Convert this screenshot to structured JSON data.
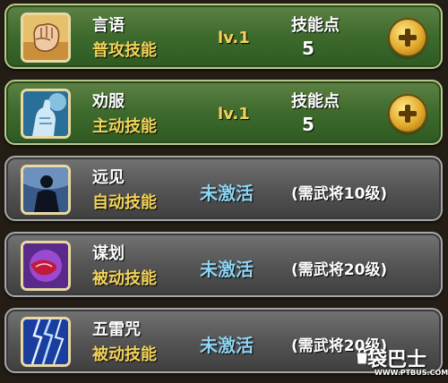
{
  "skills": [
    {
      "name": "言语",
      "type": "普攻技能",
      "level": "lv.1",
      "points_label": "技能点",
      "points_value": "5",
      "active": true,
      "icon": "fist-icon"
    },
    {
      "name": "劝服",
      "type": "主动技能",
      "level": "lv.1",
      "points_label": "技能点",
      "points_value": "5",
      "active": true,
      "icon": "scholar-icon"
    },
    {
      "name": "远见",
      "type": "自动技能",
      "status": "未激活",
      "requirement": "(需武将10级)",
      "active": false,
      "icon": "silhouette-icon"
    },
    {
      "name": "谋划",
      "type": "被动技能",
      "status": "未激活",
      "requirement": "(需武将20级)",
      "active": false,
      "icon": "purple-swirl-icon"
    },
    {
      "name": "五雷咒",
      "type": "被动技能",
      "status": "未激活",
      "requirement": "(需武将20级)",
      "active": false,
      "icon": "lightning-icon"
    }
  ],
  "watermark": {
    "main": "袋巴士",
    "sub": "WWW.PTBUS.COM"
  },
  "colors": {
    "active_row": "#3d6a2c",
    "inactive_row": "#555555",
    "type_text": "#f2d35a",
    "status_text": "#8fd3f2"
  }
}
